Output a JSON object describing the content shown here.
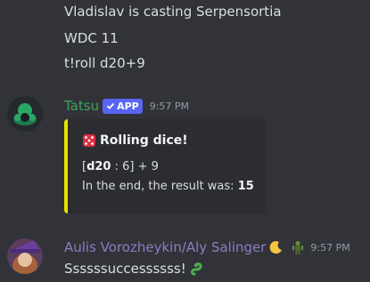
{
  "messages_top": {
    "line1": "Vladislav is casting Serpensortia",
    "line2": "WDC 11",
    "line3": "t!roll d20+9"
  },
  "tatsu": {
    "username": "Tatsu",
    "badge": "APP",
    "time": "9:57 PM",
    "username_color": "#3ba55c",
    "embed": {
      "title": "Rolling dice!",
      "roll_open": "[",
      "roll_die": "d20",
      "roll_mid": " : 6] + 9",
      "result_prefix": "In the end, the result was: ",
      "result_value": "15",
      "accent": "#e5e100"
    }
  },
  "aulis": {
    "username": "Aulis Vorozheykin/Aly Salinger",
    "time": "9:57 PM",
    "username_color": "#8e7cc3",
    "message": "Ssssssuccessssss!"
  }
}
